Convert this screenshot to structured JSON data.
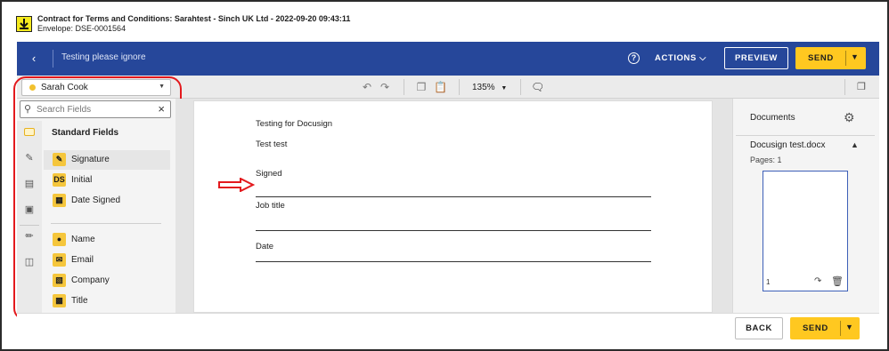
{
  "window": {
    "title": "Contract for Terms and Conditions: Sarahtest - Sinch UK Ltd - 2022-09-20 09:43:11",
    "envelope": "Envelope: DSE-0001564"
  },
  "header": {
    "envelope_title": "Testing please ignore",
    "actions_label": "ACTIONS",
    "preview_label": "PREVIEW",
    "send_label": "SEND",
    "accent_color": "#26479a",
    "send_color": "#ffc820"
  },
  "toolbar": {
    "recipient": "Sarah Cook",
    "zoom": "135%"
  },
  "fields_panel": {
    "search_placeholder": "Search Fields",
    "section_title": "Standard Fields",
    "fields": [
      {
        "label": "Signature",
        "icon": "signature-icon"
      },
      {
        "label": "Initial",
        "icon": "initial-icon",
        "glyph": "DS"
      },
      {
        "label": "Date Signed",
        "icon": "calendar-icon"
      },
      {
        "label": "Name",
        "icon": "person-icon"
      },
      {
        "label": "Email",
        "icon": "envelope-icon"
      },
      {
        "label": "Company",
        "icon": "building-icon"
      },
      {
        "label": "Title",
        "icon": "briefcase-icon"
      }
    ]
  },
  "document": {
    "lines": [
      "Testing for Docusign",
      "Test test",
      "Signed",
      "Job title",
      "Date"
    ]
  },
  "documents_panel": {
    "title": "Documents",
    "doc_name": "Docusign test.docx",
    "pages": "Pages: 1",
    "page_number": "1"
  },
  "footer": {
    "back_label": "BACK",
    "send_label": "SEND"
  }
}
